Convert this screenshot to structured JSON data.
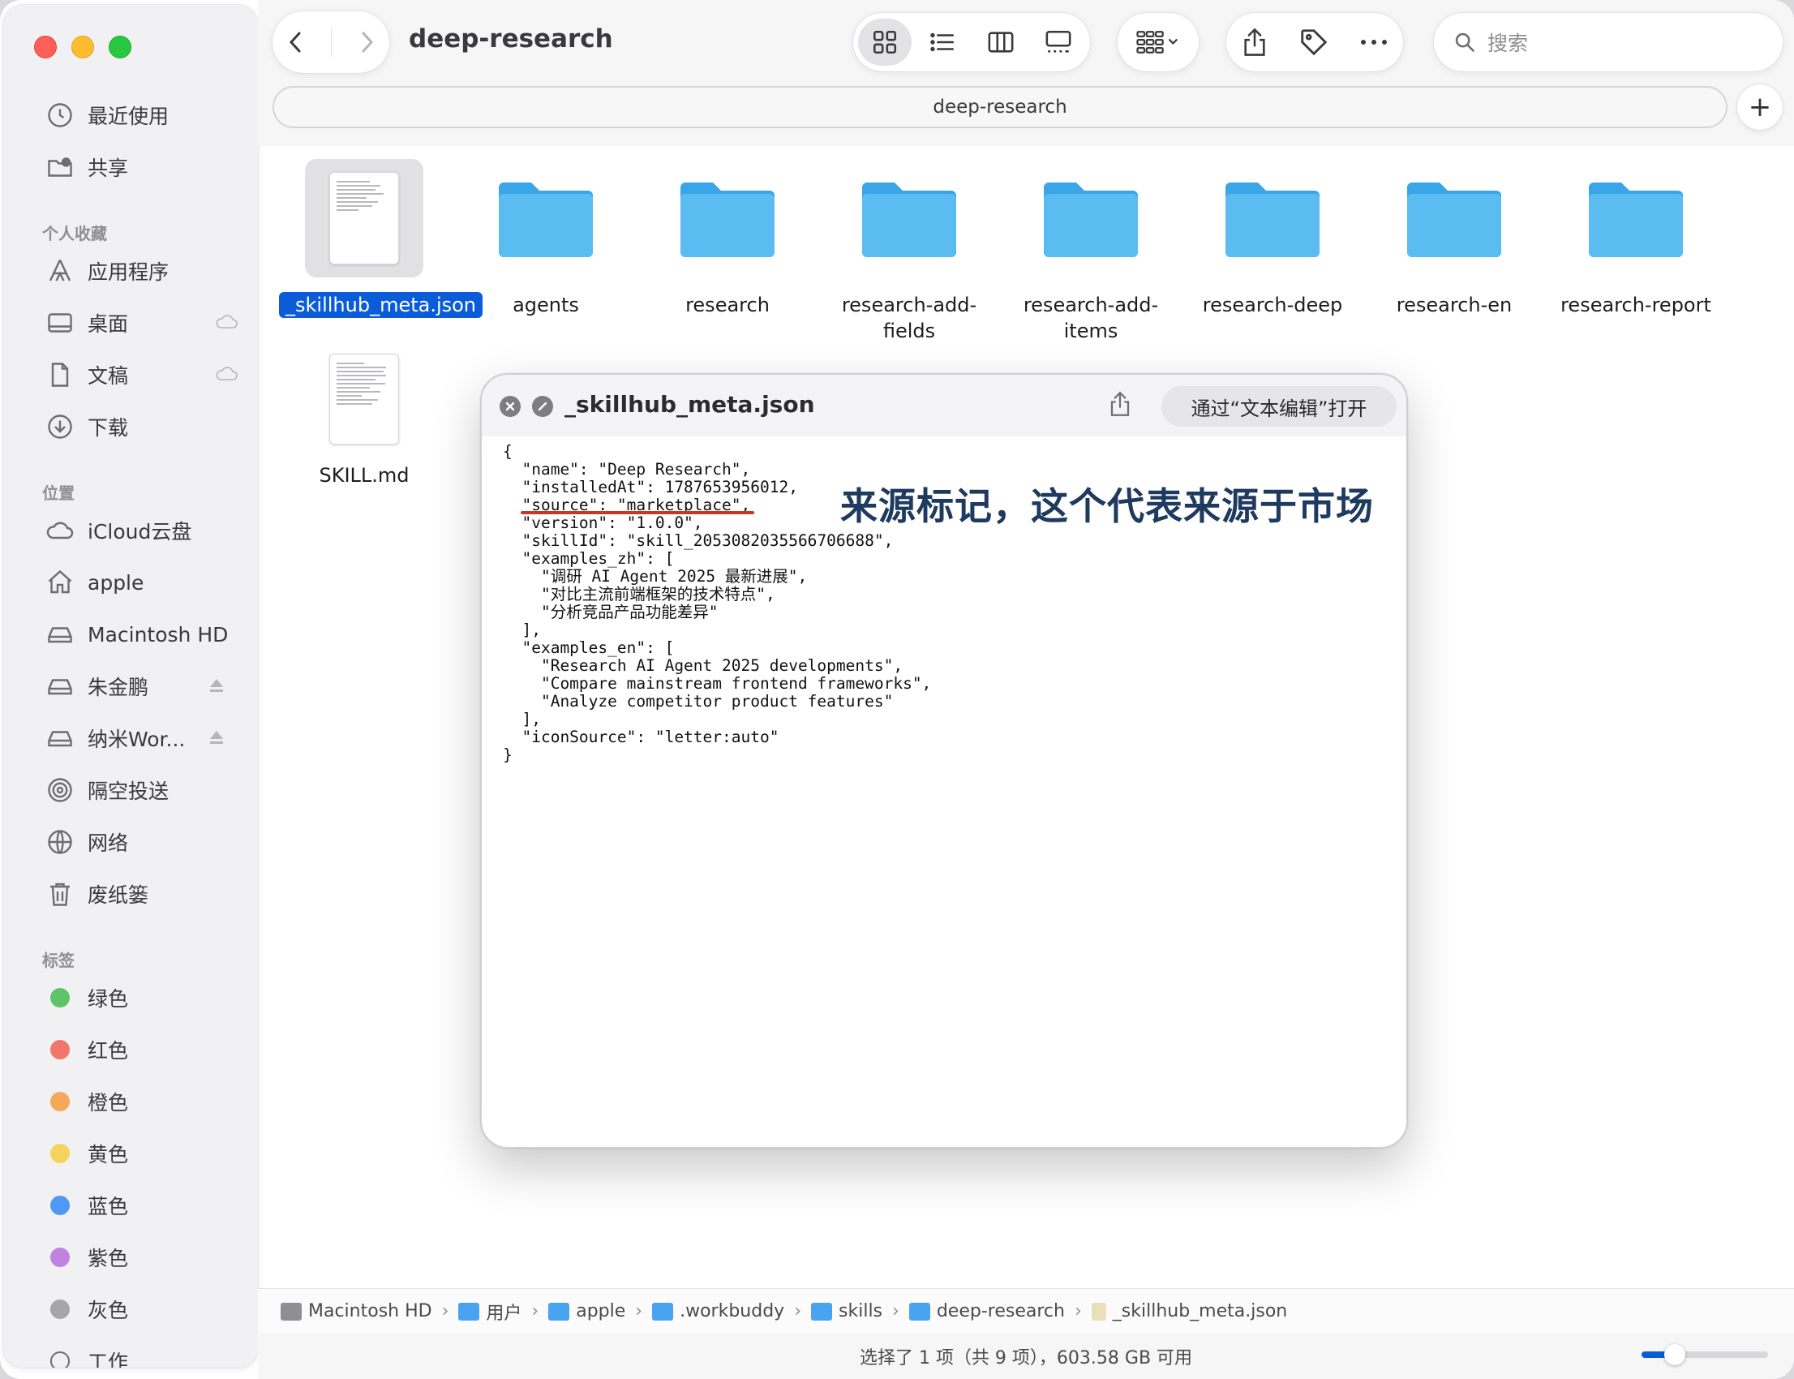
{
  "window": {
    "title": "deep-research",
    "tab_label": "deep-research",
    "search_placeholder": "搜索"
  },
  "sidebar": {
    "top_items": [
      {
        "label": "最近使用",
        "icon": "clock-icon"
      },
      {
        "label": "共享",
        "icon": "shared-folder-icon"
      }
    ],
    "favorites_heading": "个人收藏",
    "favorites": [
      {
        "label": "应用程序",
        "icon": "applications-icon"
      },
      {
        "label": "桌面",
        "icon": "desktop-icon"
      },
      {
        "label": "文稿",
        "icon": "document-icon"
      },
      {
        "label": "下载",
        "icon": "download-icon"
      }
    ],
    "locations_heading": "位置",
    "locations": [
      {
        "label": "iCloud云盘",
        "icon": "cloud-icon"
      },
      {
        "label": "apple",
        "icon": "home-icon"
      },
      {
        "label": "Macintosh HD",
        "icon": "disk-icon"
      },
      {
        "label": "朱金鹏",
        "icon": "disk-icon"
      },
      {
        "label": "纳米Wor...",
        "icon": "disk-icon"
      },
      {
        "label": "隔空投送",
        "icon": "airdrop-icon"
      },
      {
        "label": "网络",
        "icon": "network-icon"
      },
      {
        "label": "废纸篓",
        "icon": "trash-icon"
      }
    ],
    "tags_heading": "标签",
    "tags": [
      {
        "label": "绿色",
        "color": "#5fc467"
      },
      {
        "label": "红色",
        "color": "#f2766c"
      },
      {
        "label": "橙色",
        "color": "#f5a85a"
      },
      {
        "label": "黄色",
        "color": "#f5d45e"
      },
      {
        "label": "蓝色",
        "color": "#4f98f3"
      },
      {
        "label": "紫色",
        "color": "#c083e0"
      },
      {
        "label": "灰色",
        "color": "#a6a6aa"
      },
      {
        "label": "工作",
        "color": ""
      }
    ]
  },
  "files": [
    {
      "name": "_skillhub_meta.json",
      "type": "document",
      "selected": true
    },
    {
      "name": "agents",
      "type": "folder"
    },
    {
      "name": "research",
      "type": "folder"
    },
    {
      "name": "research-add-fields",
      "type": "folder"
    },
    {
      "name": "research-add-items",
      "type": "folder"
    },
    {
      "name": "research-deep",
      "type": "folder"
    },
    {
      "name": "research-en",
      "type": "folder"
    },
    {
      "name": "research-report",
      "type": "folder"
    },
    {
      "name": "SKILL.md",
      "type": "document"
    }
  ],
  "quicklook": {
    "title": "_skillhub_meta.json",
    "open_button": "通过“文本编辑”打开",
    "lines": [
      "{",
      "  \"name\": \"Deep Research\",",
      "  \"installedAt\": 1787653956012,",
      "  \"source\": \"marketplace\",",
      "  \"version\": \"1.0.0\",",
      "  \"skillId\": \"skill_2053082035566706688\",",
      "  \"examples_zh\": [",
      "    \"调研 AI Agent 2025 最新进展\",",
      "    \"对比主流前端框架的技术特点\",",
      "    \"分析竞品产品功能差异\"",
      "  ],",
      "  \"examples_en\": [",
      "    \"Research AI Agent 2025 developments\",",
      "    \"Compare mainstream frontend frameworks\",",
      "    \"Analyze competitor product features\"",
      "  ],",
      "  \"iconSource\": \"letter:auto\"",
      "}"
    ],
    "annotation": "来源标记，这个代表来源于市场"
  },
  "pathbar": [
    {
      "label": "Macintosh HD",
      "color": "#8e8e93"
    },
    {
      "label": "用户",
      "color": "#4aa3f0"
    },
    {
      "label": "apple",
      "color": "#4aa3f0"
    },
    {
      "label": ".workbuddy",
      "color": "#4aa3f0"
    },
    {
      "label": "skills",
      "color": "#4aa3f0"
    },
    {
      "label": "deep-research",
      "color": "#4aa3f0"
    },
    {
      "label": "_skillhub_meta.json",
      "color": "#e8e0b8"
    }
  ],
  "status": {
    "text": "选择了 1 项（共 9 项），603.58 GB 可用"
  }
}
